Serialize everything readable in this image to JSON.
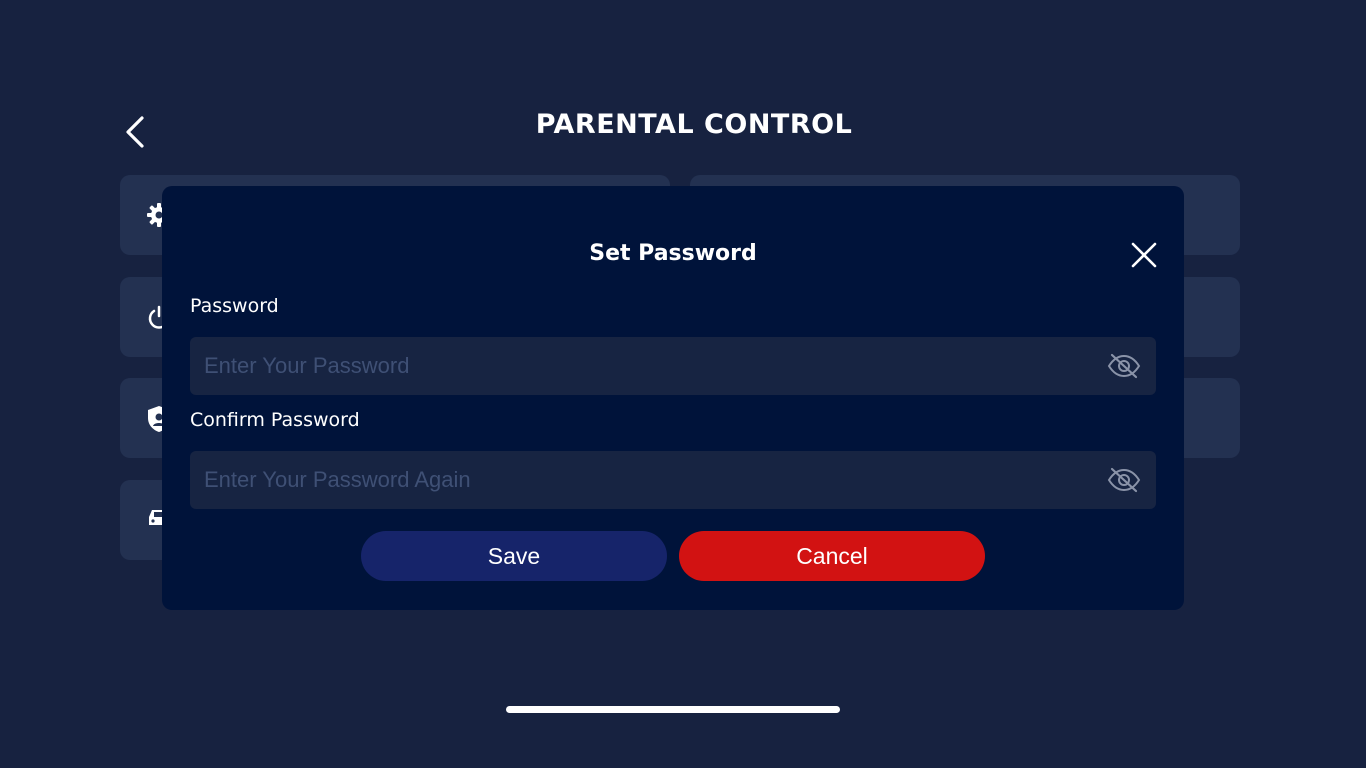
{
  "page": {
    "title": "PARENTAL CONTROL",
    "back_icon": "chevron-left-icon"
  },
  "background_cards": [
    {
      "icon": "gear-icon"
    },
    {
      "icon": "power-icon"
    },
    {
      "icon": "shield-icon"
    },
    {
      "icon": "car-icon"
    },
    {
      "icon": ""
    },
    {
      "icon": ""
    },
    {
      "icon": ""
    }
  ],
  "modal": {
    "title": "Set Password",
    "close_icon": "close-icon",
    "password": {
      "label": "Password",
      "placeholder": "Enter Your Password",
      "value": "",
      "toggle_icon": "eye-slash-icon"
    },
    "confirm_password": {
      "label": "Confirm Password",
      "placeholder": "Enter Your Password Again",
      "value": "",
      "toggle_icon": "eye-slash-icon"
    },
    "save_label": "Save",
    "cancel_label": "Cancel"
  },
  "colors": {
    "background": "#172240",
    "card": "#233151",
    "modal": "#00133a",
    "input": "#172442",
    "save_button": "#16246a",
    "cancel_button": "#d21212"
  }
}
